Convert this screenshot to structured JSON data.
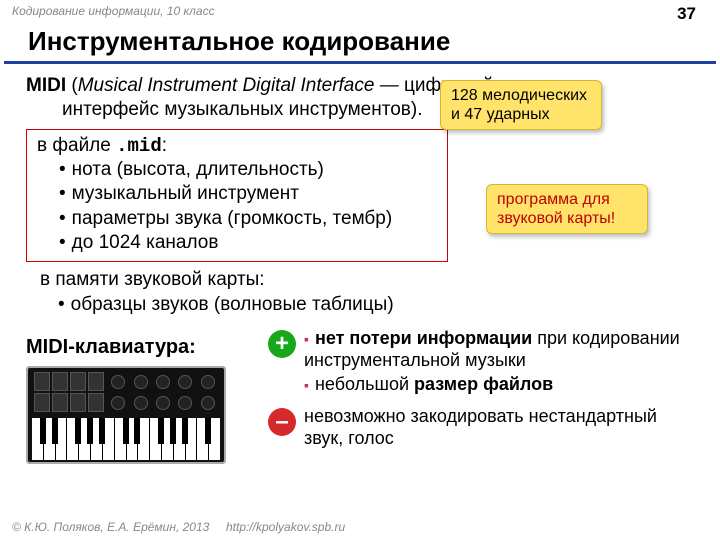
{
  "header": {
    "course": "Кодирование информации, 10 класс",
    "page": "37"
  },
  "title": "Инструментальное кодирование",
  "intro": {
    "abbr": "MIDI",
    "expansion_it": "Musical Instrument Digital Interface",
    "dash": " — цифровой",
    "line2": "интерфейс музыкальных инструментов)."
  },
  "redbox": {
    "lead": "в файле ",
    "ext": ".mid",
    "colon": ":",
    "items": [
      "нота (высота, длительность)",
      "музыкальный инструмент",
      "параметры звука (громкость, тембр)",
      "до 1024 каналов"
    ]
  },
  "callout1": {
    "l1": "128 мелодических",
    "l2": "и 47 ударных"
  },
  "callout2": {
    "l1": "программа для",
    "l2": "звуковой карты!"
  },
  "memory": {
    "lead": "в памяти звуковой карты:",
    "item": "образцы звуков (волновые таблицы)"
  },
  "kb_label": "MIDI-клавиатура:",
  "pros": {
    "p1a": "нет потери информации",
    "p1b": " при кодировании инструментальной музыки",
    "p2a": "небольшой ",
    "p2b": "размер файлов"
  },
  "cons": {
    "text": "невозможно закодировать нестандартный звук, голос"
  },
  "footer": {
    "copyright": "© К.Ю. Поляков, Е.А. Ерёмин, 2013",
    "url": "http://kpolyakov.spb.ru"
  }
}
